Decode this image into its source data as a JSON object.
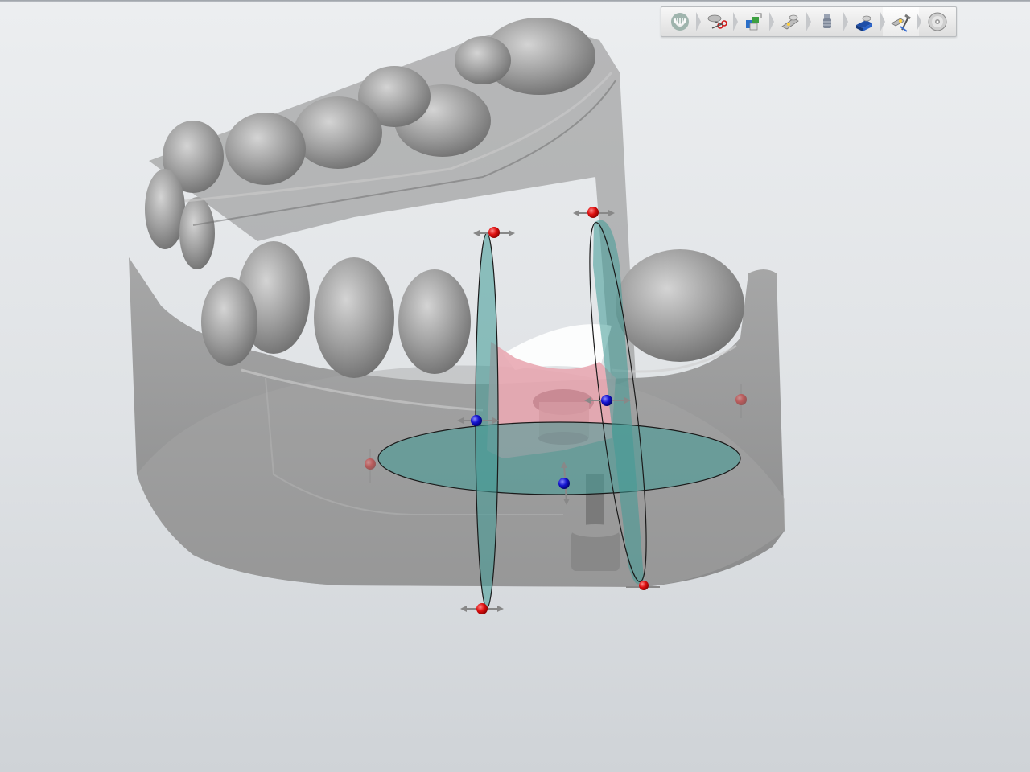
{
  "window": {
    "background_top": "#eceef0",
    "background_bottom": "#cfd3d7"
  },
  "toolbar": {
    "steps": [
      {
        "icon": "jaw-icon",
        "tooltip": ""
      },
      {
        "icon": "scissors-icon",
        "tooltip": ""
      },
      {
        "icon": "model-parts-icon",
        "tooltip": ""
      },
      {
        "icon": "die-icon",
        "tooltip": ""
      },
      {
        "icon": "implant-analog-icon",
        "tooltip": ""
      },
      {
        "icon": "model-base-icon",
        "tooltip": ""
      },
      {
        "icon": "tools-icon",
        "tooltip": ""
      },
      {
        "icon": "disc-export-icon",
        "tooltip": ""
      }
    ],
    "active_index": 6
  },
  "scene": {
    "model_color": "#8e8e8e",
    "gingiva_color": "#e9a8b2",
    "plane_color": "#3f9a96",
    "handle_red": "#e01010",
    "handle_blue": "#1414d0"
  }
}
